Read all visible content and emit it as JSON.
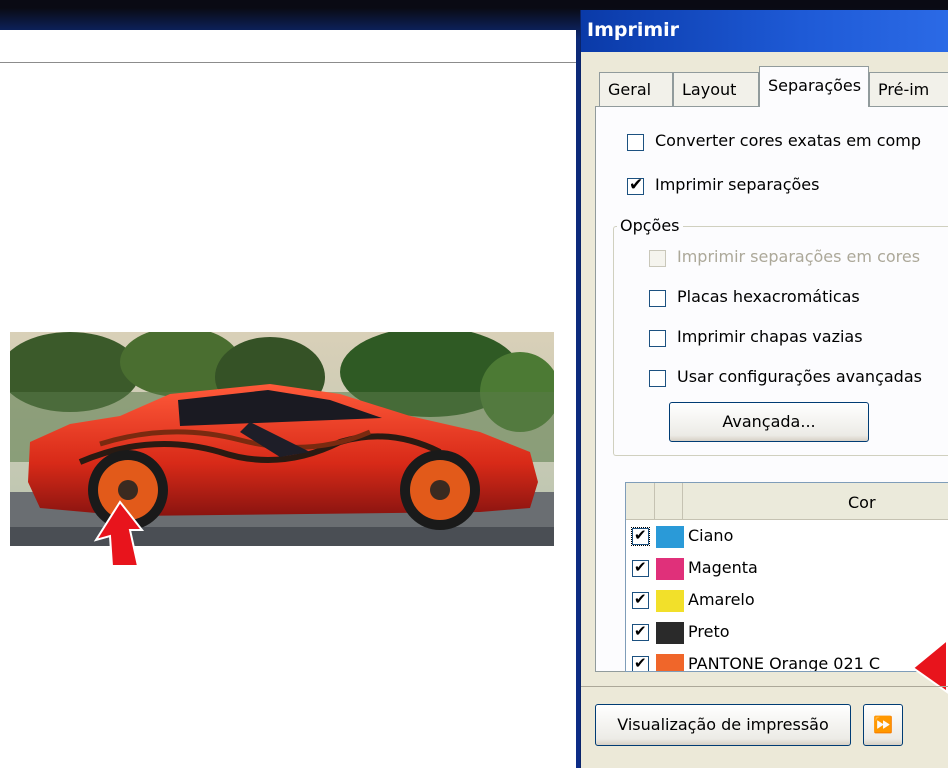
{
  "dialog": {
    "title": "Imprimir",
    "tabs": [
      {
        "label": "Geral"
      },
      {
        "label": "Layout"
      },
      {
        "label": "Separações"
      },
      {
        "label": "Pré-im"
      }
    ],
    "options": {
      "convert_spot": {
        "label": "Converter cores exatas em comp",
        "checked": false
      },
      "print_separations": {
        "label": "Imprimir separações",
        "checked": true
      }
    },
    "group": {
      "legend": "Opções",
      "items": [
        {
          "label": "Imprimir separações em cores",
          "checked": false,
          "disabled": true
        },
        {
          "label": "Placas hexacromáticas",
          "checked": false,
          "disabled": false
        },
        {
          "label": "Imprimir chapas vazias",
          "checked": false,
          "disabled": false
        },
        {
          "label": "Usar configurações avançadas",
          "checked": false,
          "disabled": false
        }
      ],
      "advanced_button": "Avançada..."
    },
    "table": {
      "column": "Cor",
      "rows": [
        {
          "name": "Ciano",
          "color": "#2a9ad8",
          "checked": true
        },
        {
          "name": "Magenta",
          "color": "#e0307a",
          "checked": true
        },
        {
          "name": "Amarelo",
          "color": "#f2e02a",
          "checked": true
        },
        {
          "name": "Preto",
          "color": "#2a2a2a",
          "checked": true
        },
        {
          "name": "PANTONE Orange 021 C",
          "color": "#f0662a",
          "checked": true
        }
      ]
    },
    "footer": {
      "preview_button": "Visualização de impressão",
      "expand_icon": "double-chevron-right-icon"
    }
  },
  "colors": {
    "background": "#0d2a7a",
    "arrow": "#e8141c",
    "titlebar": "#0a3aa8",
    "dialog": "#ece9d8"
  }
}
